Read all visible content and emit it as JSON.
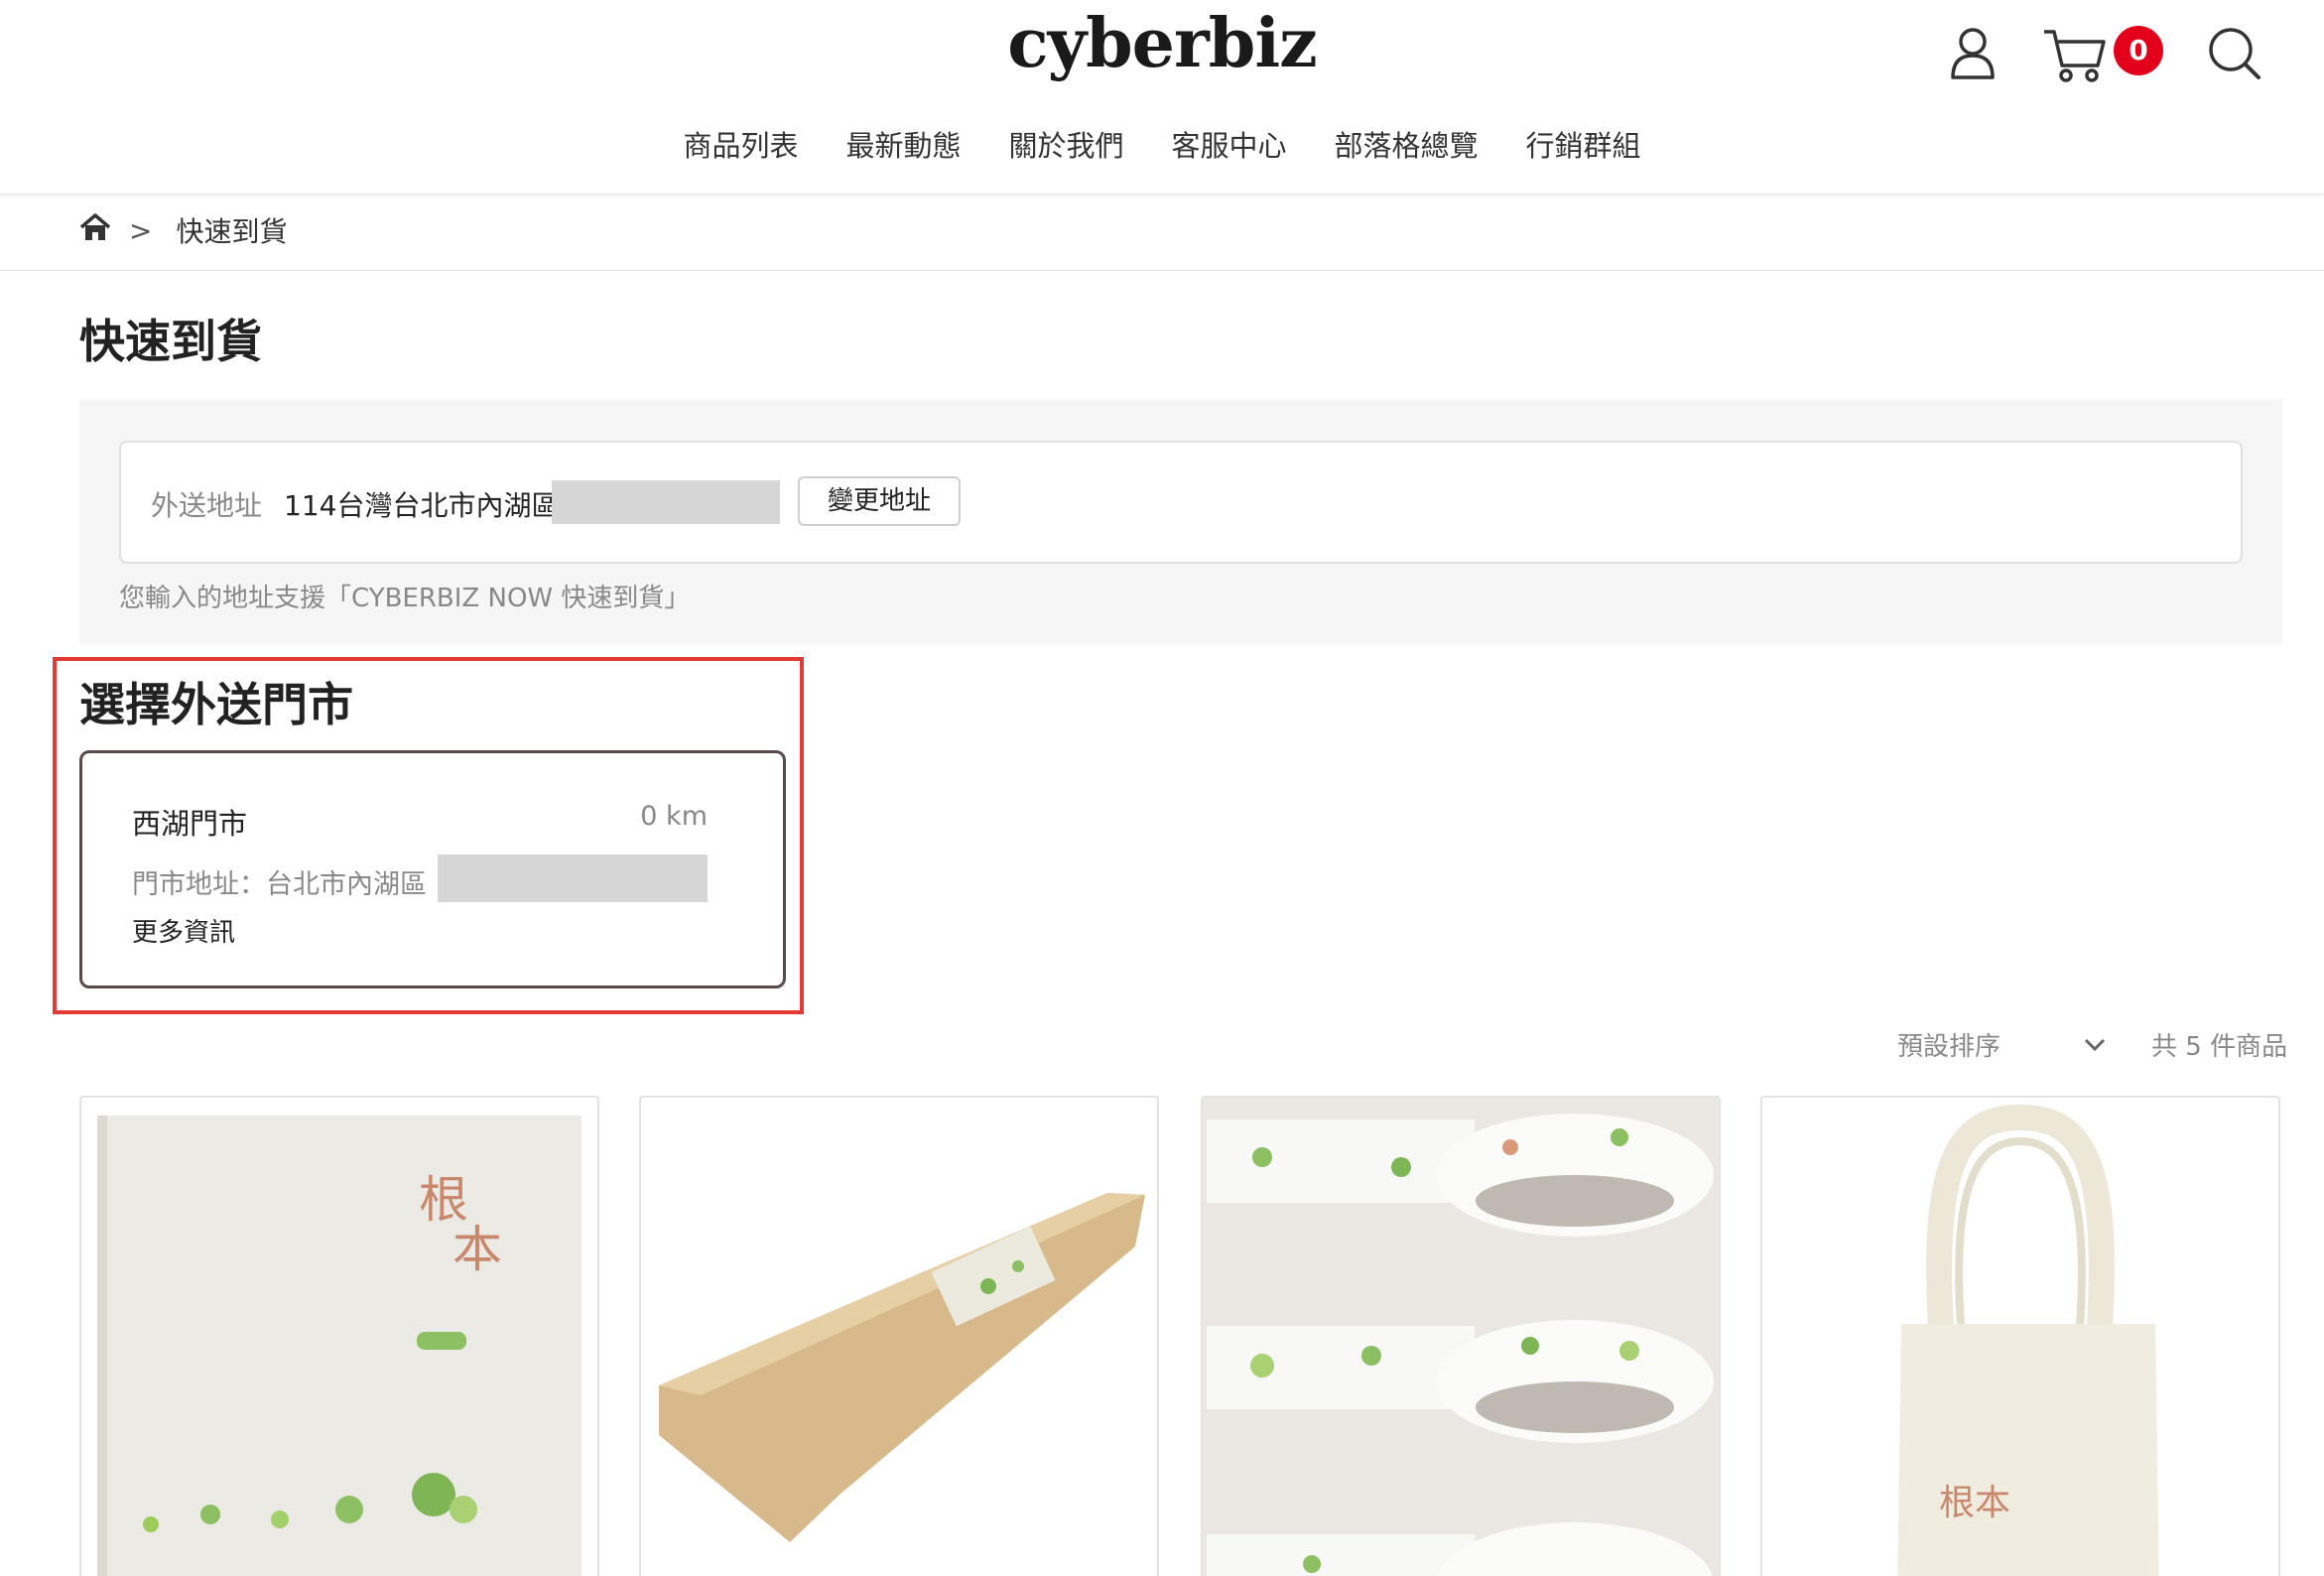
{
  "header": {
    "logo": "cyberbiz",
    "cart_count": "0",
    "icons": [
      "user-icon",
      "cart-icon",
      "search-icon"
    ]
  },
  "nav": {
    "items": [
      "商品列表",
      "最新動態",
      "關於我們",
      "客服中心",
      "部落格總覽",
      "行銷群組"
    ]
  },
  "breadcrumb": {
    "separator": ">",
    "current": "快速到貨"
  },
  "page": {
    "title": "快速到貨"
  },
  "address": {
    "label": "外送地址",
    "value": "114台灣台北市內湖區",
    "change_button": "變更地址",
    "note": "您輸入的地址支援「CYBERBIZ NOW 快速到貨」"
  },
  "store_section": {
    "title": "選擇外送門市",
    "store": {
      "name": "西湖門市",
      "distance": "0 km",
      "address": "門市地址：台北市內湖區",
      "more": "更多資訊"
    }
  },
  "listing": {
    "sort_label": "預設排序",
    "count": "共 5 件商品"
  },
  "colors": {
    "accent_red": "#e3001b",
    "highlight": "#e53935",
    "store_border": "#5a4a4a"
  }
}
